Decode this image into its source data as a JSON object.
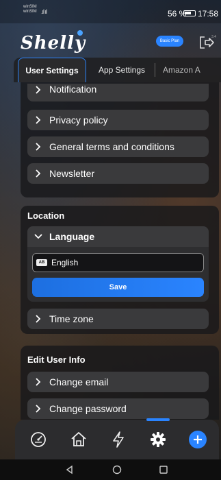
{
  "status_bar": {
    "carrier_line1": "winSIM",
    "carrier_line2": "winSIM",
    "signal_text": ".ıl ıl",
    "battery_percent": "56 %",
    "time": "17:58"
  },
  "header": {
    "logo": "Shelly",
    "version": "3.4",
    "plan_badge": "Basic Plan"
  },
  "tabs": [
    {
      "label": "User Settings",
      "active": true
    },
    {
      "label": "App Settings",
      "active": false
    },
    {
      "label": "Amazon A",
      "active": false
    }
  ],
  "menu_rows": {
    "notification": "Notification",
    "privacy": "Privacy policy",
    "terms": "General terms and conditions",
    "newsletter": "Newsletter"
  },
  "location": {
    "title": "Location",
    "language_label": "Language",
    "language_value": "English",
    "language_flag_text": "AB",
    "save_label": "Save",
    "timezone_label": "Time zone"
  },
  "edit_user": {
    "title": "Edit User Info",
    "change_email": "Change email",
    "change_password": "Change password"
  },
  "bottom_nav": {
    "items": [
      "dashboard-icon",
      "home-icon",
      "actions-icon",
      "settings-icon",
      "add-icon"
    ],
    "active": "settings-icon",
    "accent": "#2a84ff"
  }
}
